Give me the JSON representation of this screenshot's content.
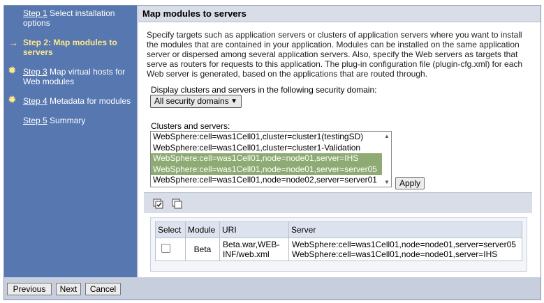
{
  "wizard": {
    "steps": [
      {
        "step_link": "Step 1",
        "label": "Select installation options",
        "marker": ""
      },
      {
        "step_link": "Step 2:",
        "label": "Map modules to servers",
        "marker": "arrow"
      },
      {
        "step_link": "Step 3",
        "label": "Map virtual hosts for Web modules",
        "marker": "star"
      },
      {
        "step_link": "Step 4",
        "label": "Metadata for modules",
        "marker": "star"
      },
      {
        "step_link": "Step 5",
        "label": "Summary",
        "marker": ""
      }
    ]
  },
  "main": {
    "title": "Map modules to servers",
    "description": "Specify targets such as application servers or clusters of application servers where you want to install the modules that are contained in your application. Modules can be installed on the same application server or dispersed among several application servers. Also, specify the Web servers as targets that serve as routers for requests to this application. The plug-in configuration file (plugin-cfg.xml) for each Web server is generated, based on the applications that are routed through.",
    "domain_label": "Display clusters and servers in the following security domain:",
    "domain_selected": "All security domains",
    "clusters_label": "Clusters and servers:",
    "clusters": [
      {
        "text": "WebSphere:cell=was1Cell01,cluster=cluster1(testingSD)",
        "selected": false
      },
      {
        "text": "WebSphere:cell=was1Cell01,cluster=cluster1-Validation",
        "selected": false
      },
      {
        "text": "WebSphere:cell=was1Cell01,node=node01,server=IHS",
        "selected": true
      },
      {
        "text": "WebSphere:cell=was1Cell01,node=node01,server=server05",
        "selected": true
      },
      {
        "text": "WebSphere:cell=was1Cell01,node=node02,server=server01",
        "selected": false
      }
    ],
    "apply_label": "Apply",
    "toolbar_icons": [
      "select-all-icon",
      "deselect-all-icon"
    ],
    "table": {
      "headers": [
        "Select",
        "Module",
        "URI",
        "Server"
      ],
      "rows": [
        {
          "module": "Beta",
          "uri_line1": "Beta.war,WEB-",
          "uri_line2": "INF/web.xml",
          "server_line1": "WebSphere:cell=was1Cell01,node=node01,server=server05",
          "server_line2": "WebSphere:cell=was1Cell01,node=node01,server=IHS"
        }
      ]
    }
  },
  "buttons": {
    "previous": "Previous",
    "next": "Next",
    "cancel": "Cancel"
  },
  "colors": {
    "nav_bg": "#5677b0",
    "current_step": "#ffe98a",
    "selected_option": "#8fab74"
  }
}
